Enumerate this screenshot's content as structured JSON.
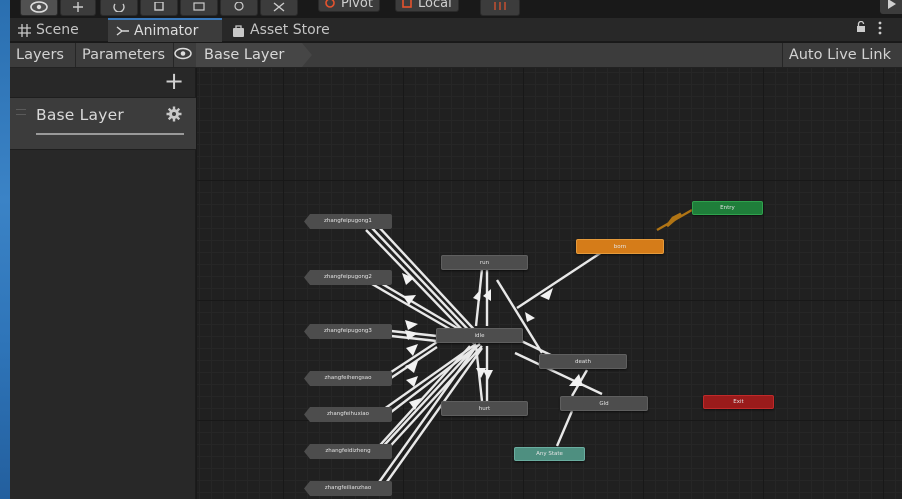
{
  "toolbar": {
    "tools": [
      "view-tool",
      "move-tool",
      "rotate-tool",
      "scale-tool",
      "rect-tool",
      "transform-tool",
      "custom-tool"
    ],
    "pivot_label": "Pivot",
    "local_label": "Local"
  },
  "tabs": [
    {
      "label": "Scene",
      "icon": "grid-icon"
    },
    {
      "label": "Animator",
      "icon": "animator-icon",
      "active": true
    },
    {
      "label": "Asset Store",
      "icon": "store-bag-icon"
    }
  ],
  "breadcrumb": {
    "layers_tab": "Layers",
    "parameters_tab": "Parameters",
    "current_layer": "Base Layer",
    "auto_live_link": "Auto Live Link"
  },
  "layers_panel": {
    "add_symbol": "+",
    "layers": [
      {
        "name": "Base Layer"
      }
    ]
  },
  "graph": {
    "colors": {
      "default_state": "#4d4d4d",
      "default_state_orange": "#d57c19",
      "entry": "#1f7e3a",
      "exit": "#9a1b1b",
      "any_state": "#4e8f80"
    },
    "states": [
      {
        "name": "zhangfeipugong1",
        "kind": "sub-state"
      },
      {
        "name": "zhangfeipugong2",
        "kind": "sub-state"
      },
      {
        "name": "zhangfeipugong3",
        "kind": "sub-state"
      },
      {
        "name": "zhangfeihengsao",
        "kind": "sub-state"
      },
      {
        "name": "zhangfeihuxiao",
        "kind": "sub-state"
      },
      {
        "name": "zhangfeidizheng",
        "kind": "sub-state"
      },
      {
        "name": "zhangfeilianzhao",
        "kind": "sub-state"
      },
      {
        "name": "run",
        "kind": "state"
      },
      {
        "name": "idle",
        "kind": "state"
      },
      {
        "name": "hurt",
        "kind": "state"
      },
      {
        "name": "death",
        "kind": "state"
      },
      {
        "name": "Gld",
        "kind": "state"
      },
      {
        "name": "born",
        "kind": "default-state"
      },
      {
        "name": "Entry",
        "kind": "entry"
      },
      {
        "name": "Exit",
        "kind": "exit"
      },
      {
        "name": "Any State",
        "kind": "any-state"
      }
    ]
  }
}
